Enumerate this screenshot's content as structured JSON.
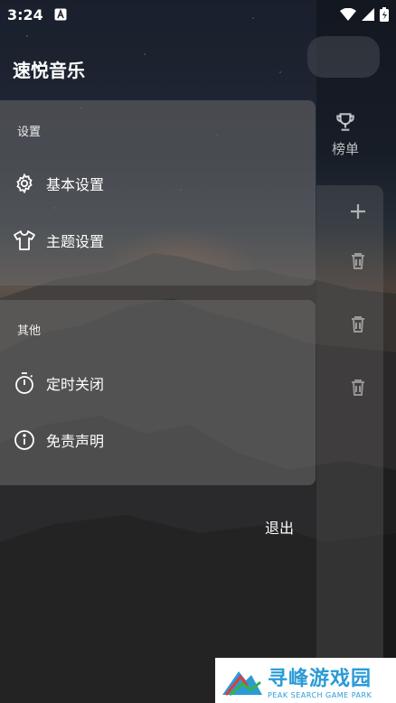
{
  "status_bar": {
    "time": "3:24"
  },
  "drawer": {
    "title": "速悦音乐",
    "settings_section": {
      "label": "设置",
      "items": [
        {
          "label": "基本设置",
          "icon": "gear-icon"
        },
        {
          "label": "主题设置",
          "icon": "tshirt-icon"
        }
      ]
    },
    "other_section": {
      "label": "其他",
      "items": [
        {
          "label": "定时关闭",
          "icon": "stopwatch-icon"
        },
        {
          "label": "免责声明",
          "icon": "info-icon"
        }
      ]
    },
    "exit_label": "退出"
  },
  "background_ui": {
    "rank_tab_label": "榜单"
  },
  "watermark": {
    "cn": "寻峰游戏园",
    "en": "PEAK SEARCH GAME PARK"
  },
  "colors": {
    "card_bg": "#696969",
    "watermark_blue": "#2a9bd6"
  }
}
